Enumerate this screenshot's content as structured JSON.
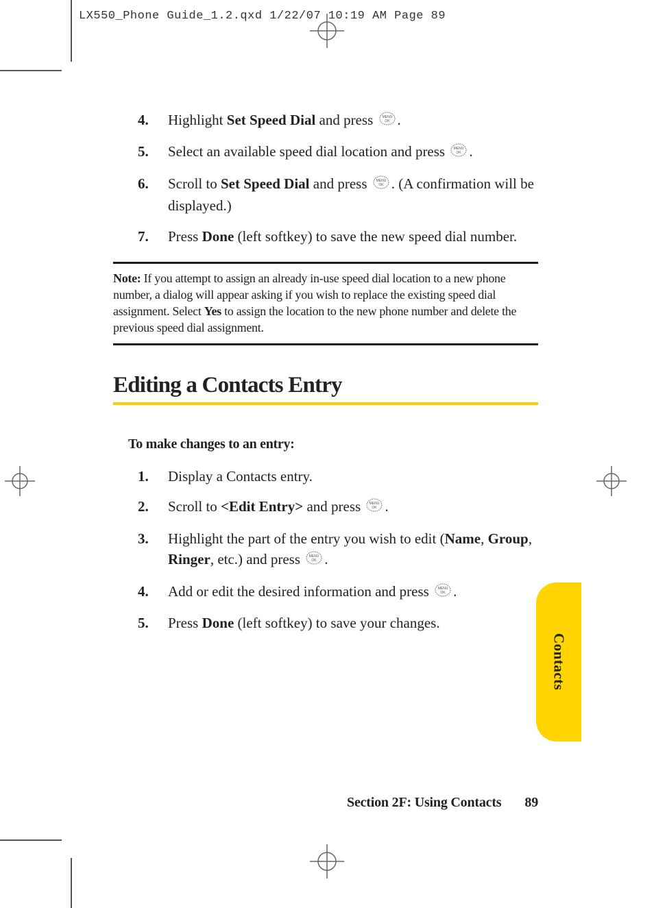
{
  "slug": "LX550_Phone Guide_1.2.qxd  1/22/07  10:19 AM  Page 89",
  "list_a": [
    {
      "n": "4.",
      "pre": "Highlight ",
      "bold": "Set Speed Dial",
      "post": " and press ",
      "icon": true,
      "tail": "."
    },
    {
      "n": "5.",
      "pre": "Select an available speed dial location and press ",
      "bold": "",
      "post": "",
      "icon": true,
      "tail": "."
    },
    {
      "n": "6.",
      "pre": "Scroll to ",
      "bold": "Set Speed Dial",
      "post": " and press ",
      "icon": true,
      "tail": ". (A confirmation will be displayed.)"
    },
    {
      "n": "7.",
      "pre": "Press ",
      "bold": "Done",
      "post": " (left softkey) to save the new speed dial number.",
      "icon": false,
      "tail": ""
    }
  ],
  "note": {
    "label": "Note:",
    "body_pre": " If you attempt to assign an already in-use speed dial location to a new phone number, a dialog will appear asking if you wish to replace the existing speed dial assignment. Select ",
    "bold": "Yes",
    "body_post": " to assign the location to the new phone number and delete the previous speed dial assignment."
  },
  "heading": "Editing a Contacts Entry",
  "sub_intro": "To make changes to an entry:",
  "list_b": [
    {
      "n": "1.",
      "text": "Display a Contacts entry."
    },
    {
      "n": "2.",
      "pre": "Scroll to ",
      "bold": "<Edit Entry>",
      "post": " and press ",
      "icon": true,
      "tail": "."
    },
    {
      "n": "3.",
      "pre": "Highlight the part of the entry you wish to edit (",
      "bold1": "Name",
      "mid1": ", ",
      "bold2": "Group",
      "mid2": ", ",
      "bold3": "Ringer",
      "post": ", etc.) and press ",
      "icon": true,
      "tail": "."
    },
    {
      "n": "4.",
      "pre": "Add or edit the desired information and press ",
      "icon": true,
      "tail": "."
    },
    {
      "n": "5.",
      "pre": "Press ",
      "bold": "Done",
      "post": " (left softkey) to save your changes."
    }
  ],
  "side_tab": "Contacts",
  "footer": {
    "section": "Section 2F: Using Contacts",
    "page": "89"
  }
}
